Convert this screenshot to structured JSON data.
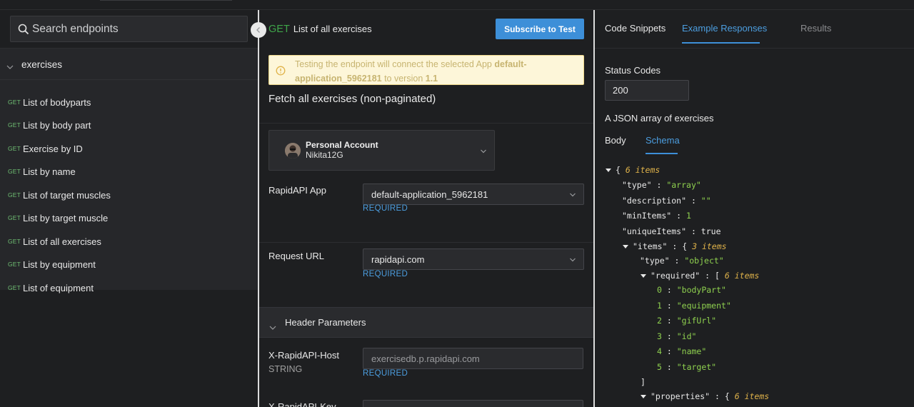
{
  "sidebar": {
    "search_placeholder": "Search endpoints",
    "group_label": "exercises",
    "endpoints": [
      {
        "method": "GET",
        "name": "List of bodyparts"
      },
      {
        "method": "GET",
        "name": "List by body part"
      },
      {
        "method": "GET",
        "name": "Exercise by ID"
      },
      {
        "method": "GET",
        "name": "List by name"
      },
      {
        "method": "GET",
        "name": "List of target muscles"
      },
      {
        "method": "GET",
        "name": "List by target muscle"
      },
      {
        "method": "GET",
        "name": "List of all exercises"
      },
      {
        "method": "GET",
        "name": "List by equipment"
      },
      {
        "method": "GET",
        "name": "List of equipment"
      }
    ]
  },
  "center": {
    "method": "GET",
    "title": "List of all exercises",
    "subscribe_label": "Subscribe to Test",
    "warning_pre": "Testing the endpoint will connect the selected App ",
    "warning_app": "default-application_5962181",
    "warning_mid": " to version ",
    "warning_version": "1.1",
    "description": "Fetch all exercises (non-paginated)",
    "account_title": "Personal Account",
    "account_user": "Nikita12G",
    "app_label": "RapidAPI App",
    "app_value": "default-application_5962181",
    "required": "REQUIRED",
    "url_label": "Request URL",
    "url_value": "rapidapi.com",
    "header_params_label": "Header Parameters",
    "host_label": "X-RapidAPI-Host",
    "host_type": "STRING",
    "host_value": "exercisedb.p.rapidapi.com",
    "key_label": "X-RapidAPI-Key"
  },
  "right": {
    "tabs": [
      "Code Snippets",
      "Example Responses",
      "Results"
    ],
    "status_codes_label": "Status Codes",
    "status_code": "200",
    "array_desc": "A JSON array of exercises",
    "body_tabs": [
      "Body",
      "Schema"
    ],
    "schema": {
      "root_count": "6 items",
      "type_key": "\"type\"",
      "type_val": "\"array\"",
      "desc_key": "\"description\"",
      "desc_val": "\"\"",
      "min_key": "\"minItems\"",
      "min_val": "1",
      "unique_key": "\"uniqueItems\"",
      "unique_val": "true",
      "items_key": "\"items\"",
      "items_count": "3 items",
      "items_type_key": "\"type\"",
      "items_type_val": "\"object\"",
      "required_key": "\"required\"",
      "required_count": "6 items",
      "required_values": [
        "\"bodyPart\"",
        "\"equipment\"",
        "\"gifUrl\"",
        "\"id\"",
        "\"name\"",
        "\"target\""
      ],
      "properties_key": "\"properties\"",
      "properties_count": "6 items"
    }
  },
  "colors": {
    "accent": "#3d8fd8",
    "get_method": "#3fa64a",
    "json_value": "#8fd14f",
    "json_count": "#e0b34a",
    "warning_bg": "#fdf6d9"
  }
}
